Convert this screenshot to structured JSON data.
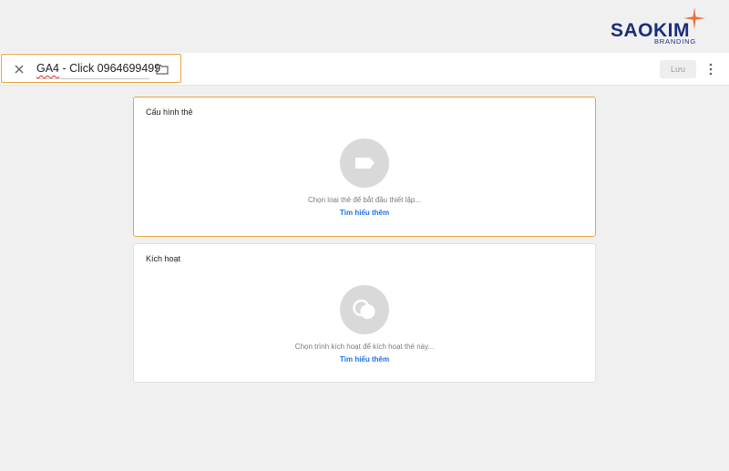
{
  "brand": {
    "name": "SAOKIM",
    "sub": "BRANDING",
    "color": "#1c2e7a",
    "accent": "#e8733d"
  },
  "header": {
    "title_prefix": "GA4",
    "title_rest": " - Click 0964699499",
    "close_icon": "close-icon",
    "folder_icon": "folder-icon",
    "save_label": "Lưu",
    "more_icon": "more-vert-icon"
  },
  "cards": {
    "config": {
      "title": "Cấu hình thẻ",
      "icon": "tag-icon",
      "description": "Chọn loại thẻ để bắt đầu thiết lập...",
      "link": "Tìm hiểu thêm"
    },
    "trigger": {
      "title": "Kích hoạt",
      "icon": "trigger-icon",
      "description": "Chọn trình kích hoạt để kích hoạt thẻ này...",
      "link": "Tìm hiểu thêm"
    }
  },
  "colors": {
    "focus_border": "#e8a33d",
    "link": "#1a73e8",
    "background": "#f0f0f1"
  }
}
